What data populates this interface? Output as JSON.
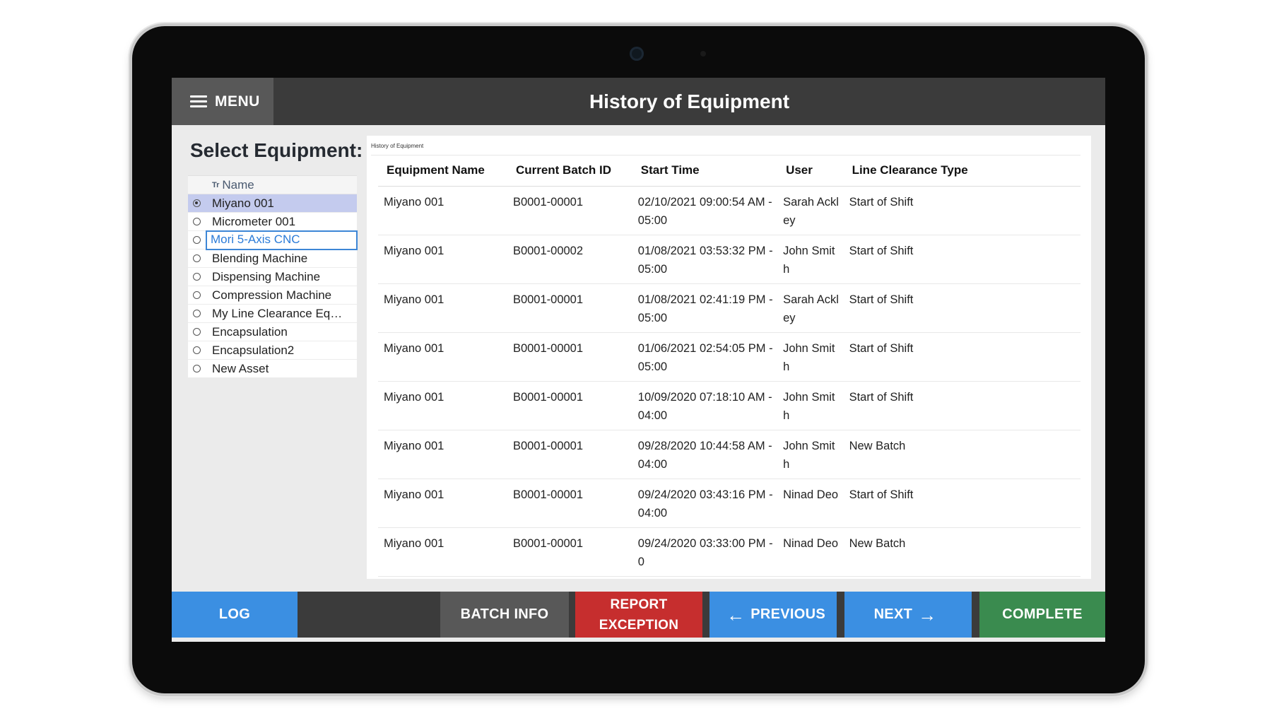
{
  "header": {
    "menu_label": "MENU",
    "title": "History of Equipment"
  },
  "left_panel": {
    "title": "Select Equipment:",
    "column_header": "Name",
    "items": [
      {
        "label": "Miyano 001",
        "selected": true
      },
      {
        "label": "Micrometer 001",
        "selected": false
      },
      {
        "label": "Mori 5-Axis CNC",
        "selected": false,
        "focused": true
      },
      {
        "label": "Blending Machine",
        "selected": false
      },
      {
        "label": "Dispensing Machine",
        "selected": false
      },
      {
        "label": "Compression Machine",
        "selected": false
      },
      {
        "label": "My Line Clearance Eq…",
        "selected": false
      },
      {
        "label": "Encapsulation",
        "selected": false
      },
      {
        "label": "Encapsulation2",
        "selected": false
      },
      {
        "label": "New Asset",
        "selected": false
      }
    ]
  },
  "table": {
    "caption": "History of Equipment",
    "columns": [
      "Equipment Name",
      "Current Batch ID",
      "Start Time",
      "User",
      "Line Clearance Type"
    ],
    "rows": [
      [
        "Miyano 001",
        "B0001-00001",
        "02/10/2021 09:00:54 AM -05:00",
        "Sarah Ackley",
        "Start of Shift"
      ],
      [
        "Miyano 001",
        "B0001-00002",
        "01/08/2021 03:53:32 PM -05:00",
        "John Smith",
        "Start of Shift"
      ],
      [
        "Miyano 001",
        "B0001-00001",
        "01/08/2021 02:41:19 PM -05:00",
        "Sarah Ackley",
        "Start of Shift"
      ],
      [
        "Miyano 001",
        "B0001-00001",
        "01/06/2021 02:54:05 PM -05:00",
        "John Smith",
        "Start of Shift"
      ],
      [
        "Miyano 001",
        "B0001-00001",
        "10/09/2020 07:18:10 AM -04:00",
        "John Smith",
        "Start of Shift"
      ],
      [
        "Miyano 001",
        "B0001-00001",
        "09/28/2020 10:44:58 AM -04:00",
        "John Smith",
        "New Batch"
      ],
      [
        "Miyano 001",
        "B0001-00001",
        "09/24/2020 03:43:16 PM -04:00",
        "Ninad Deo",
        "Start of Shift"
      ],
      [
        "Miyano 001",
        "B0001-00001",
        "09/24/2020 03:33:00 PM -0",
        "Ninad Deo",
        "New Batch"
      ]
    ]
  },
  "bottom_bar": {
    "log": "LOG",
    "batch_info": "BATCH INFO",
    "report_line1": "REPORT",
    "report_line2": "EXCEPTION",
    "previous": "PREVIOUS",
    "next": "NEXT",
    "complete": "COMPLETE"
  },
  "colors": {
    "header": "#3b3b3b",
    "primary_blue": "#3b8fe2",
    "danger_red": "#c62e2e",
    "success_green": "#3a8b4f",
    "selected_row": "#c4cbee"
  }
}
